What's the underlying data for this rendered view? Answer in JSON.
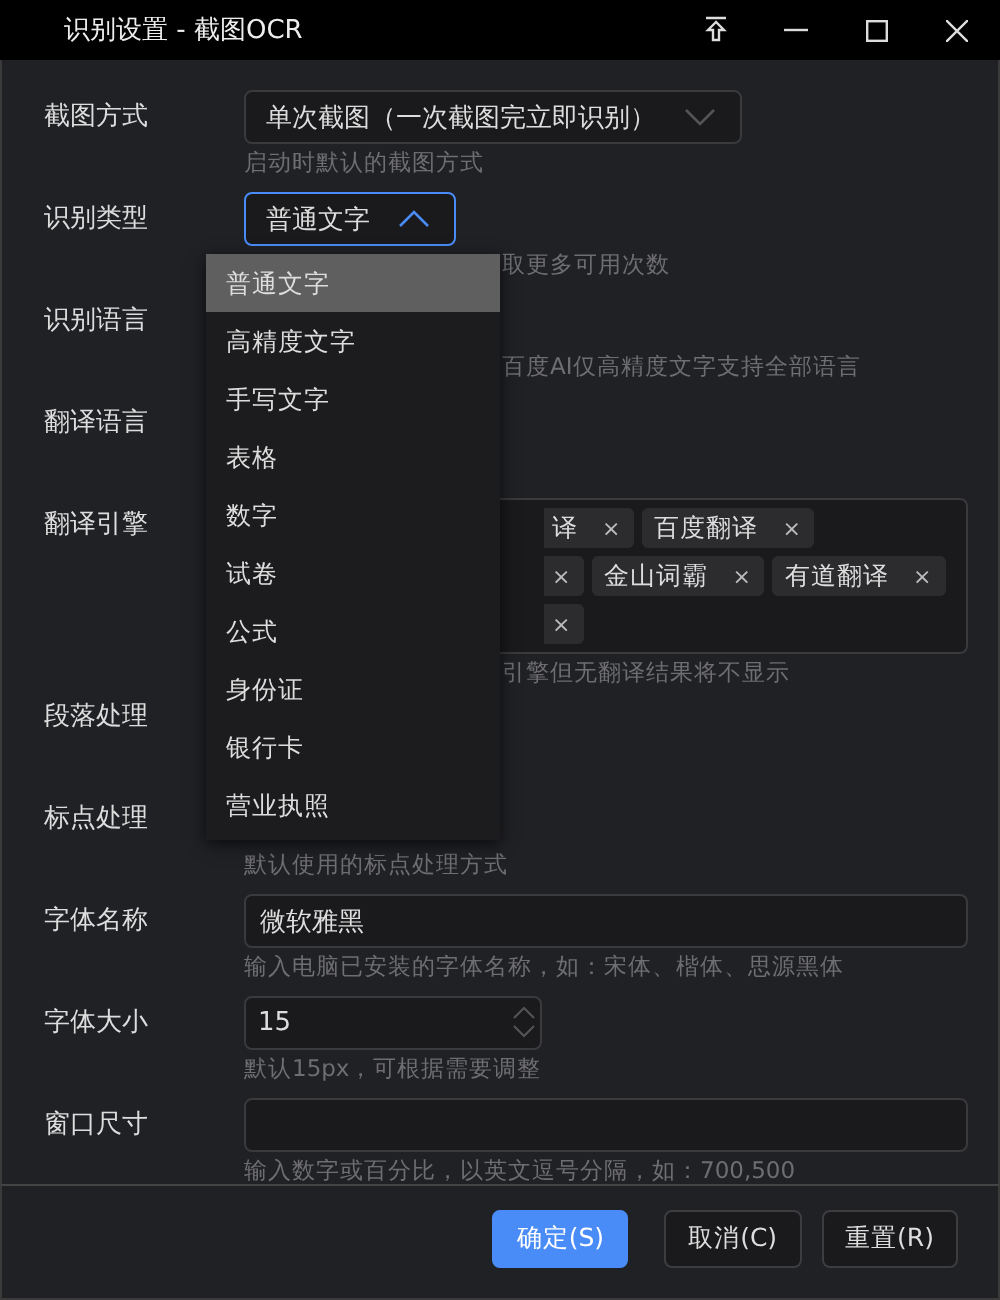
{
  "window": {
    "title": "识别设置 - 截图OCR"
  },
  "fields": [
    {
      "label": "截图方式",
      "kind": "select",
      "value": "单次截图（一次截图完立即识别）",
      "expanded": false,
      "hint": "启动时默认的截图方式"
    },
    {
      "label": "识别类型",
      "kind": "select",
      "value": "普通文字",
      "expanded": true,
      "hint": "取更多可用次数",
      "options": [
        {
          "label": "普通文字",
          "selected": true
        },
        {
          "label": "高精度文字",
          "selected": false
        },
        {
          "label": "手写文字",
          "selected": false
        },
        {
          "label": "表格",
          "selected": false
        },
        {
          "label": "数字",
          "selected": false
        },
        {
          "label": "试卷",
          "selected": false
        },
        {
          "label": "公式",
          "selected": false
        },
        {
          "label": "身份证",
          "selected": false
        },
        {
          "label": "银行卡",
          "selected": false
        },
        {
          "label": "营业执照",
          "selected": false
        }
      ]
    },
    {
      "label": "识别语言",
      "kind": "covered",
      "hint": "百度AI仅高精度文字支持全部语言"
    },
    {
      "label": "翻译语言",
      "kind": "covered"
    },
    {
      "label": "翻译引擎",
      "kind": "tags",
      "hint": "引擎但无翻译结果将不显示",
      "tag_rows": [
        [
          {
            "kind": "cut",
            "label": "译",
            "remove": "×"
          },
          {
            "kind": "full",
            "label": "百度翻译",
            "remove": "×"
          }
        ],
        [
          {
            "kind": "cut",
            "remove": "×"
          },
          {
            "kind": "full",
            "label": "金山词霸",
            "remove": "×"
          },
          {
            "kind": "full",
            "label": "有道翻译",
            "remove": "×"
          }
        ],
        [
          {
            "kind": "cut",
            "remove": "×"
          }
        ]
      ]
    },
    {
      "label": "段落处理",
      "kind": "covered"
    },
    {
      "label": "标点处理",
      "kind": "covered",
      "hint": "默认使用的标点处理方式"
    },
    {
      "label": "字体名称",
      "kind": "text",
      "value": "微软雅黑",
      "hint": "输入电脑已安装的字体名称，如：宋体、楷体、思源黑体"
    },
    {
      "label": "字体大小",
      "kind": "number",
      "value": "15",
      "hint": "默认15px，可根据需要调整"
    },
    {
      "label": "窗口尺寸",
      "kind": "text",
      "hint": "输入数字或百分比，以英文逗号分隔，如：700,500"
    }
  ],
  "buttons": [
    {
      "label": "确定(S)",
      "primary": true
    },
    {
      "label": "取消(C)",
      "primary": false
    },
    {
      "label": "重置(R)",
      "primary": false
    }
  ]
}
